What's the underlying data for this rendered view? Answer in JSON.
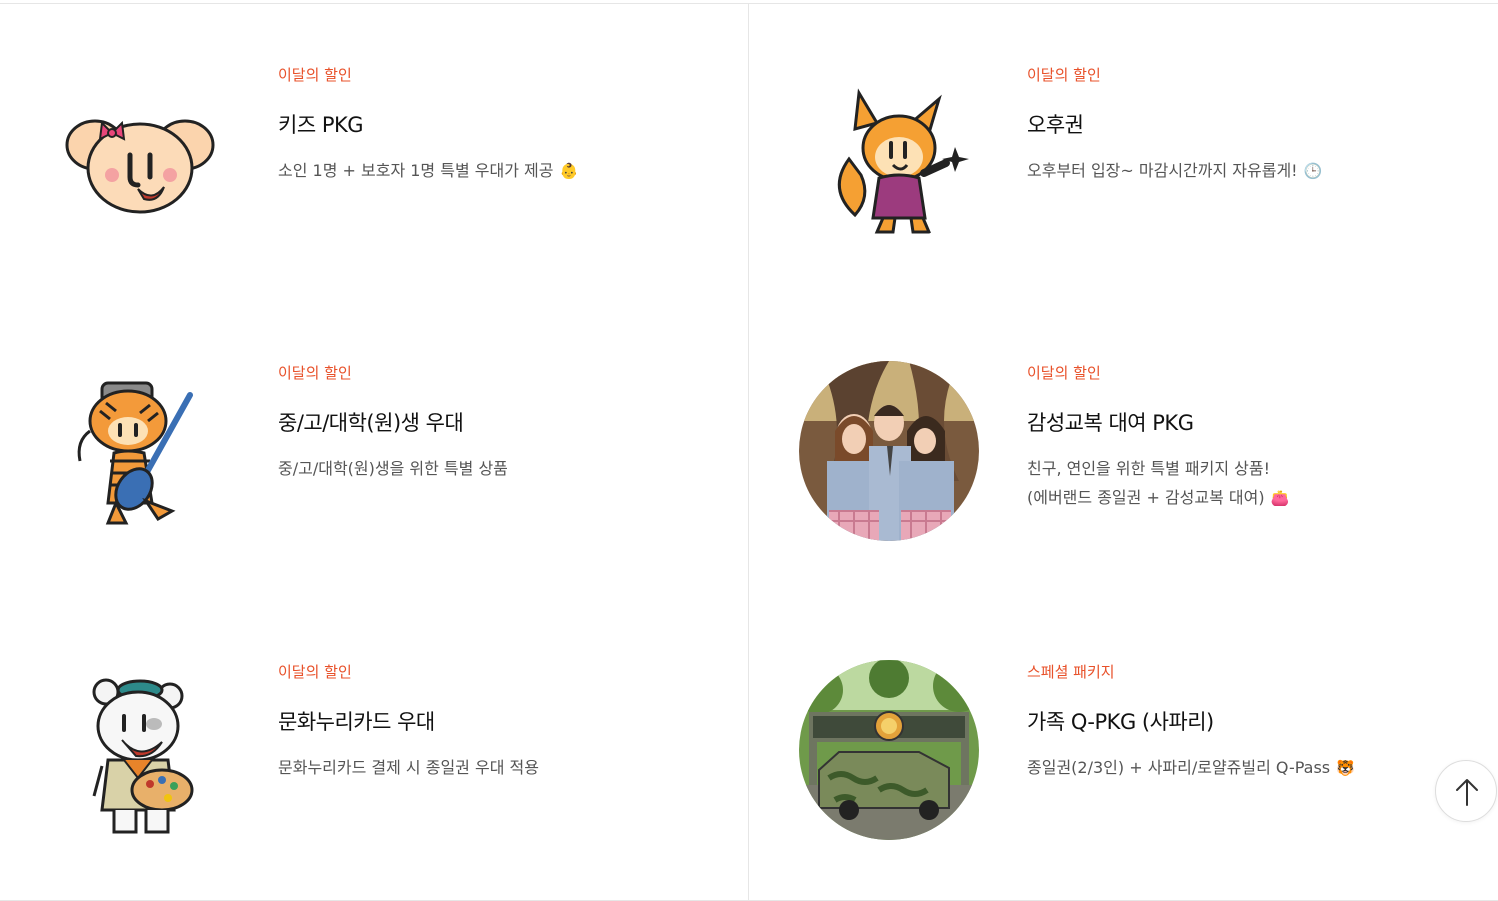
{
  "cards": [
    {
      "tag": "이달의 할인",
      "title": "키즈 PKG",
      "desc1": "소인 1명 + 보호자 1명 특별 우대가 제공",
      "desc2": "",
      "emoji": "👶",
      "image": "mouse-mascot-icon"
    },
    {
      "tag": "이달의 할인",
      "title": "오후권",
      "desc1": "오후부터 입장~ 마감시간까지 자유롭게!",
      "desc2": "",
      "emoji": "🕒",
      "image": "fox-mascot-icon"
    },
    {
      "tag": "이달의 할인",
      "title": "중/고/대학(원)생 우대",
      "desc1": "중/고/대학(원)생을 위한 특별 상품",
      "desc2": "",
      "emoji": "",
      "image": "tiger-guitar-mascot-icon"
    },
    {
      "tag": "이달의 할인",
      "title": "감성교복 대여 PKG",
      "desc1": "친구, 연인을 위한 특별 패키지 상품!",
      "desc2": "(에버랜드 종일권 + 감성교복 대여)",
      "emoji": "👛",
      "image": "school-uniform-photo"
    },
    {
      "tag": "이달의 할인",
      "title": "문화누리카드 우대",
      "desc1": "문화누리카드 결제 시 종일권 우대 적용",
      "desc2": "",
      "emoji": "",
      "image": "bear-painter-mascot-icon"
    },
    {
      "tag": "스페셜 패키지",
      "title": "가족 Q-PKG (사파리)",
      "desc1": "종일권(2/3인) + 사파리/로얄쥬빌리 Q-Pass",
      "desc2": "",
      "emoji": "🐯",
      "image": "safari-world-photo"
    }
  ],
  "scroll_top_icon": "arrow-up-icon",
  "colors": {
    "accent": "#e8512a",
    "border": "#e6e6e6",
    "text": "#111111",
    "muted": "#555555"
  }
}
